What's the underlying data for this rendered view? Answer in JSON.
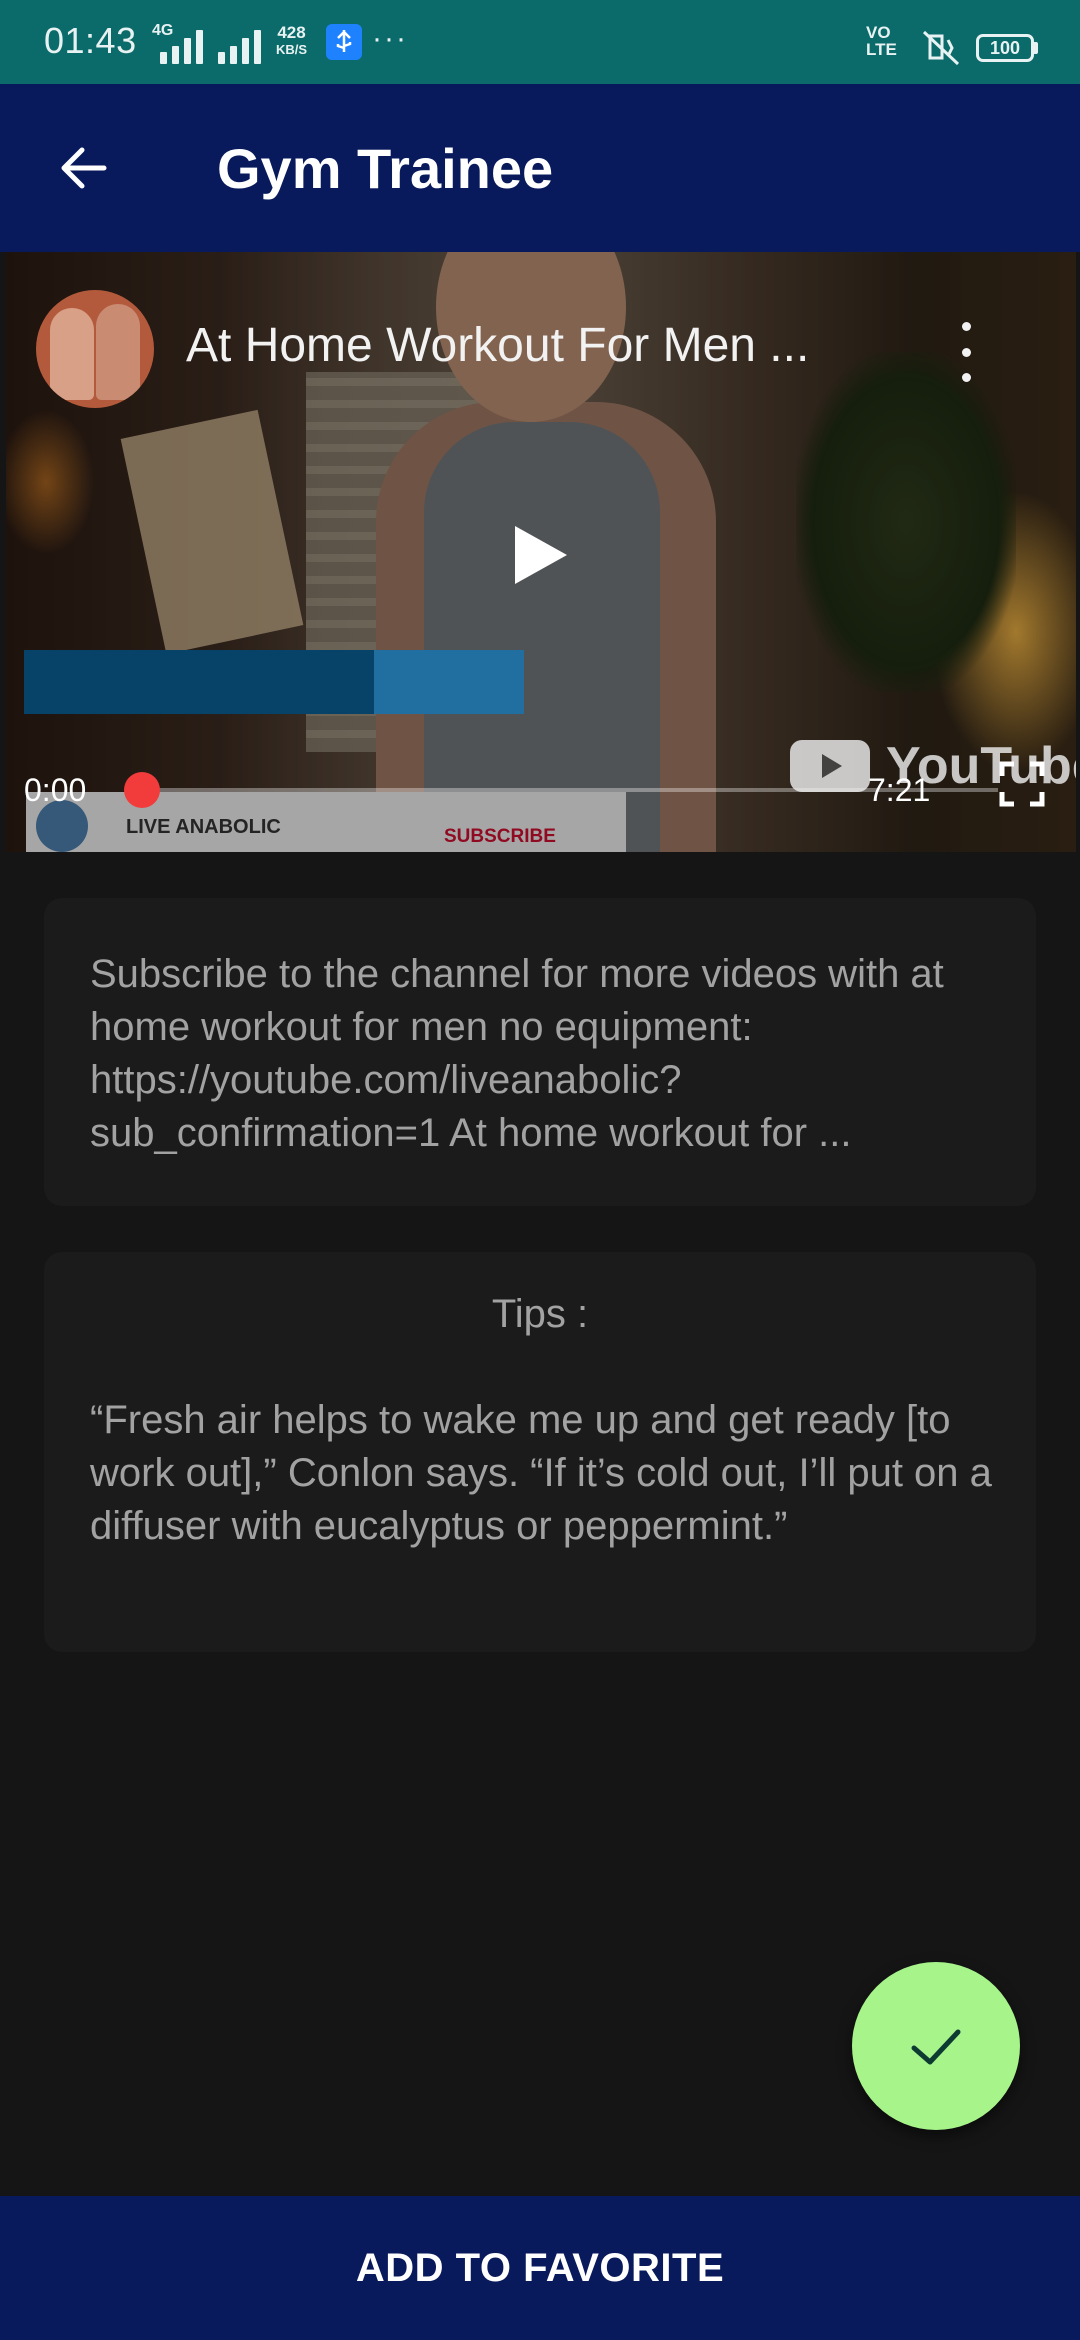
{
  "status_bar": {
    "time": "01:43",
    "network_type": "4G",
    "speed_value": "428",
    "speed_unit": "KB/S",
    "overflow": "···",
    "volte": "VO\nLTE",
    "battery": "100"
  },
  "app_bar": {
    "title": "Gym Trainee",
    "back_icon": "arrow-left-icon"
  },
  "video": {
    "title": "At Home Workout For Men ...",
    "current_time": "0:00",
    "duration": "7:21",
    "progress": 0.0,
    "watermark": "YouTube",
    "subscribe_overlay": {
      "channel": "LIVE ANABOLIC",
      "subscribe": "SUBSCRIBE"
    }
  },
  "description": {
    "text": "Subscribe to the channel for more videos with at home workout for men no equipment: https://youtube.com/liveanabolic?sub_confirmation=1 At home workout for ..."
  },
  "tips": {
    "label": "Tips :",
    "text": "“Fresh air helps to wake me up and get ready [to work out],” Conlon says. “If it’s cold out, I’ll put on a diffuser with eucalyptus or peppermint.”"
  },
  "fab": {
    "icon": "check-icon",
    "color": "#a6f48a"
  },
  "bottom_button": {
    "label": "ADD TO FAVORITE",
    "color": "#081a5c"
  },
  "colors": {
    "status_bar": "#0b6b6a",
    "app_bar": "#081a5c",
    "background": "#151515",
    "card": "#1b1b1b",
    "progress_knob": "#f23b3b"
  }
}
